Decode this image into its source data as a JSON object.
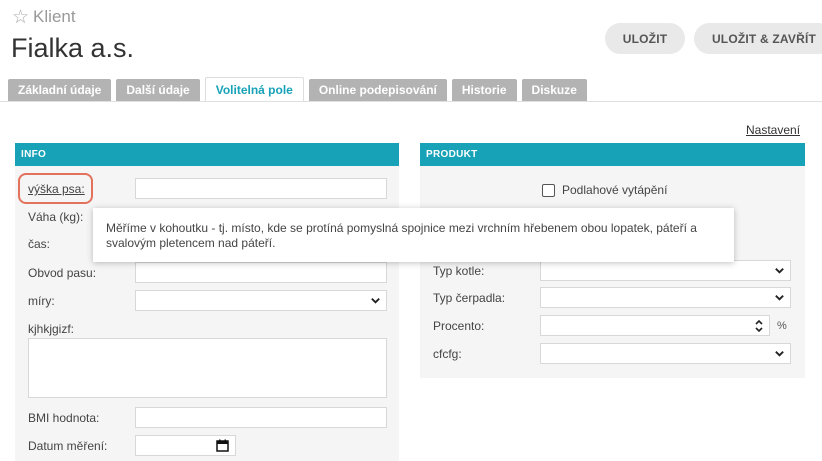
{
  "header": {
    "entity_type": "Klient",
    "title": "Fialka a.s.",
    "save_label": "ULOŽIT",
    "save_close_label": "ULOŽIT & ZAVŘÍT"
  },
  "tabs": [
    {
      "label": "Základní údaje",
      "active": false
    },
    {
      "label": "Další údaje",
      "active": false
    },
    {
      "label": "Volitelná pole",
      "active": true
    },
    {
      "label": "Online podepisování",
      "active": false
    },
    {
      "label": "Historie",
      "active": false
    },
    {
      "label": "Diskuze",
      "active": false
    }
  ],
  "settings_link": "Nastavení",
  "info": {
    "title": "INFO",
    "fields": {
      "vyska_psa": {
        "label": "výška psa:",
        "value": ""
      },
      "vaha": {
        "label": "Váha (kg):",
        "value": ""
      },
      "cas": {
        "label": "čas:",
        "value": ""
      },
      "obvod_pasu": {
        "label": "Obvod pasu:",
        "value": ""
      },
      "miry": {
        "label": "míry:",
        "value": ""
      },
      "kjhkjgizf": {
        "label": "kjhkjgizf:",
        "value": ""
      },
      "bmi": {
        "label": "BMI hodnota:",
        "value": ""
      },
      "datum_mereni": {
        "label": "Datum měření:",
        "value": ""
      }
    }
  },
  "tooltip": {
    "text": "Měříme v kohoutku - tj. místo, kde se protíná pomyslná spojnice mezi vrchním hřebenem obou lopatek, páteří a svalovým pletencem nad páteří."
  },
  "produkt": {
    "title": "PRODUKT",
    "podlahove_vytapeni": {
      "label": "Podlahové vytápění",
      "checked": false
    },
    "typ_kotle": {
      "label": "Typ kotle:",
      "value": ""
    },
    "typ_cerpadla": {
      "label": "Typ čerpadla:",
      "value": ""
    },
    "procento": {
      "label": "Procento:",
      "value": "",
      "unit": "%"
    },
    "cfcfg": {
      "label": "cfcfg:",
      "value": ""
    }
  },
  "colors": {
    "accent": "#17a2b8",
    "highlight": "#e2725b",
    "tab_inactive": "#b3b3b3"
  }
}
